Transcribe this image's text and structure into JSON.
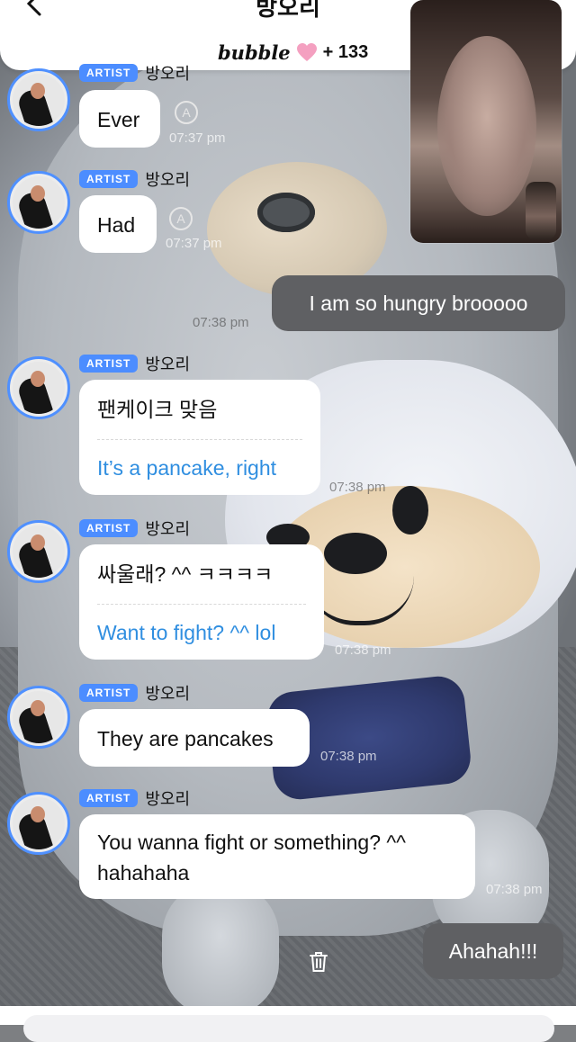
{
  "header": {
    "title": "방오리",
    "brand": "bubble",
    "count": "+ 133"
  },
  "messages": [
    {
      "type": "in",
      "badge": "ARTIST",
      "sender": "방오리",
      "text": "Ever",
      "time": "07:37 pm"
    },
    {
      "type": "in",
      "badge": "ARTIST",
      "sender": "방오리",
      "text": "Had",
      "time": "07:37 pm"
    },
    {
      "type": "out",
      "text": "I am so hungry brooooo",
      "time": "07:38 pm"
    },
    {
      "type": "in",
      "badge": "ARTIST",
      "sender": "방오리",
      "text": "팬케이크 맞음",
      "translation": "It’s a pancake, right",
      "time": "07:38 pm"
    },
    {
      "type": "in",
      "badge": "ARTIST",
      "sender": "방오리",
      "text": "싸울래? ^^ ㅋㅋㅋㅋ",
      "translation": "Want to fight? ^^ lol",
      "time": "07:38 pm"
    },
    {
      "type": "in",
      "badge": "ARTIST",
      "sender": "방오리",
      "text": "They are pancakes",
      "time": "07:38 pm"
    },
    {
      "type": "in",
      "badge": "ARTIST",
      "sender": "방오리",
      "text": "You wanna fight or something? ^^ hahahaha",
      "time": "07:38 pm"
    },
    {
      "type": "out",
      "text": "Ahahah!!!"
    }
  ],
  "colors": {
    "badge": "#4c8dff",
    "translation": "#2f8ee0",
    "out_bubble": "#5f6063",
    "heart": "#f4a0c0"
  },
  "icons": {
    "back": "chevron-left-icon",
    "heart": "heart-icon",
    "read": "read-status-icon",
    "trash": "trash-icon"
  }
}
